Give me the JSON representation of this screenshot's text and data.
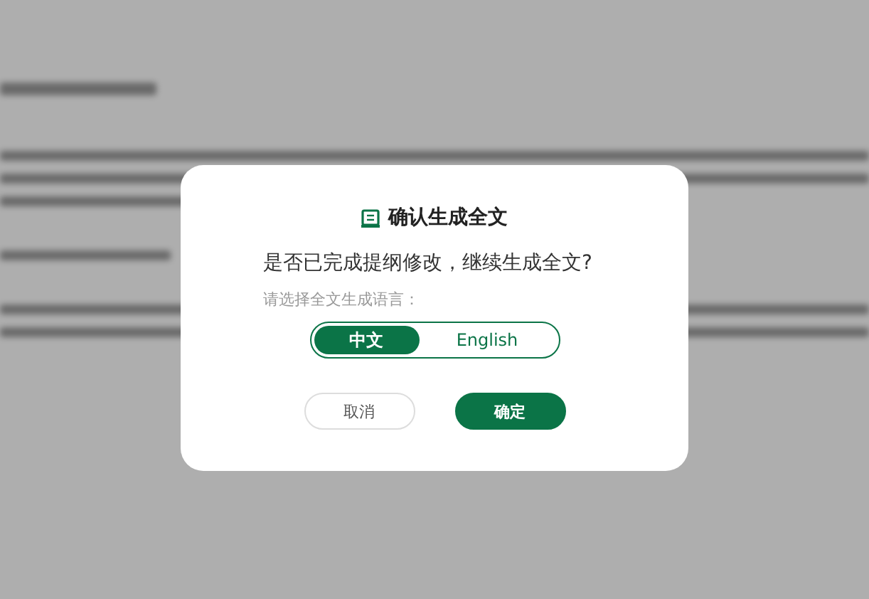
{
  "dialog": {
    "title": "确认生成全文",
    "question": "是否已完成提纲修改，继续生成全文?",
    "language_label": "请选择全文生成语言：",
    "languages": [
      {
        "label": "中文",
        "selected": true
      },
      {
        "label": "English",
        "selected": false
      }
    ],
    "buttons": [
      {
        "label": "取消",
        "kind": "secondary"
      },
      {
        "label": "确定",
        "kind": "primary"
      }
    ]
  }
}
